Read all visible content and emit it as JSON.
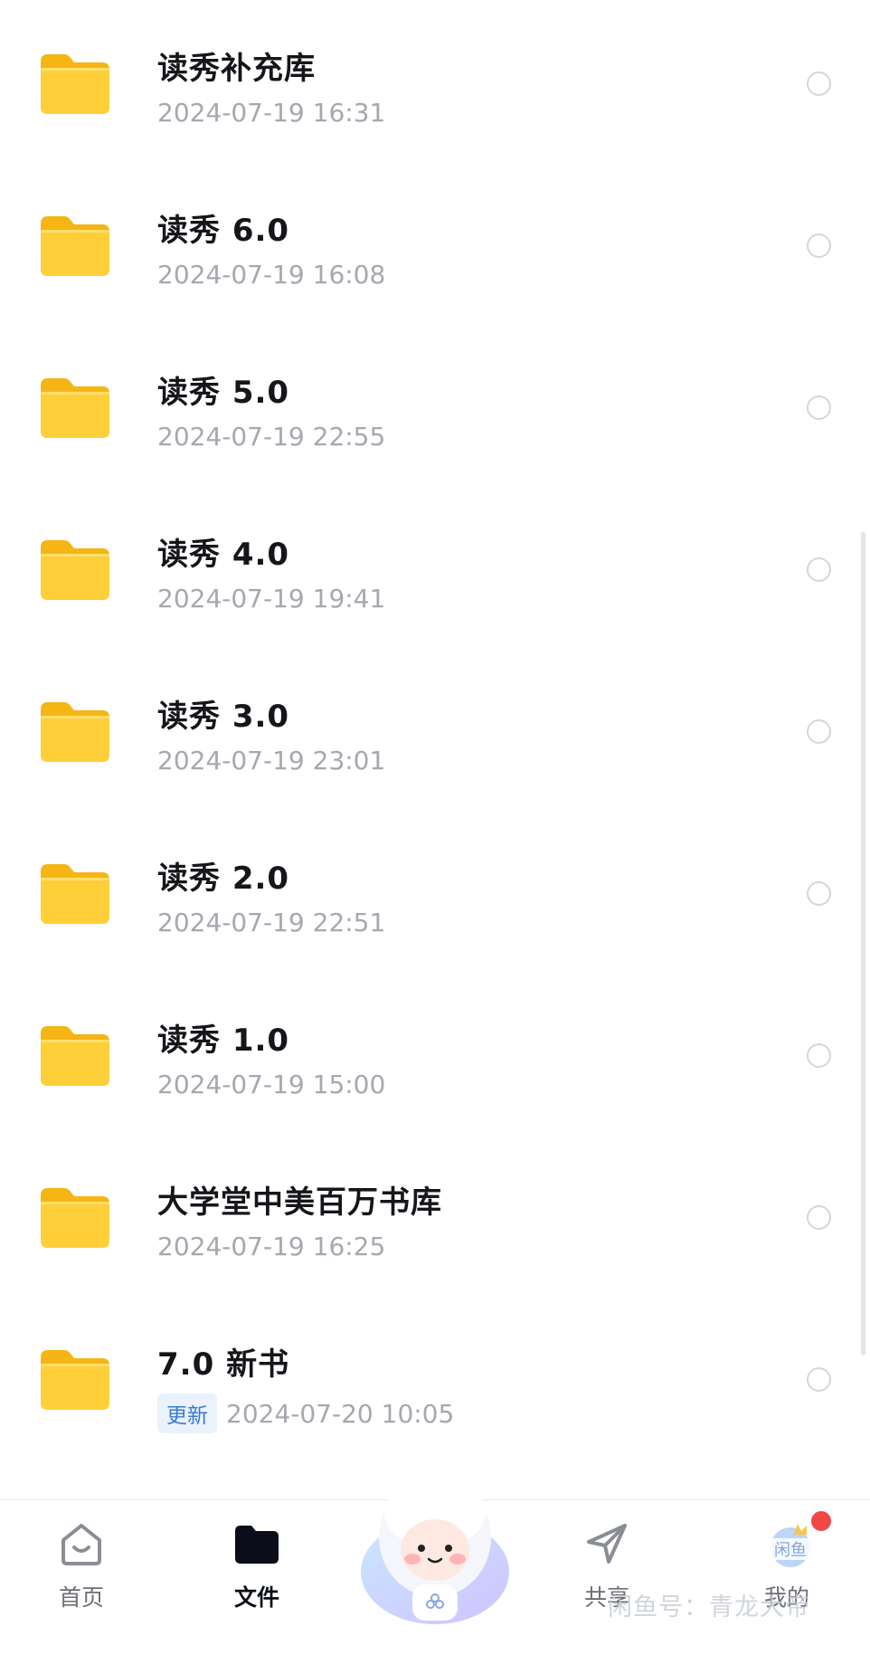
{
  "files": [
    {
      "name": "读秀补充库",
      "date": "2024-07-19 16:31",
      "badge": ""
    },
    {
      "name": "读秀 6.0",
      "date": "2024-07-19 16:08",
      "badge": ""
    },
    {
      "name": "读秀 5.0",
      "date": "2024-07-19 22:55",
      "badge": ""
    },
    {
      "name": "读秀 4.0",
      "date": "2024-07-19 19:41",
      "badge": ""
    },
    {
      "name": "读秀 3.0",
      "date": "2024-07-19 23:01",
      "badge": ""
    },
    {
      "name": "读秀 2.0",
      "date": "2024-07-19 22:51",
      "badge": ""
    },
    {
      "name": "读秀 1.0",
      "date": "2024-07-19 15:00",
      "badge": ""
    },
    {
      "name": "大学堂中美百万书库",
      "date": "2024-07-19 16:25",
      "badge": ""
    },
    {
      "name": "7.0 新书",
      "date": "2024-07-20 10:05",
      "badge": "更新"
    }
  ],
  "tabbar": {
    "home": {
      "label": "首页",
      "icon": "home-icon"
    },
    "files": {
      "label": "文件",
      "icon": "folder-icon"
    },
    "share": {
      "label": "共享",
      "icon": "send-icon"
    },
    "mine": {
      "label": "我的",
      "icon": "avatar"
    }
  },
  "watermark": "闲鱼号：青龙大帝",
  "colors": {
    "folder": "#FFCB2E",
    "accent": "#3A7BD5",
    "badge_bg": "#EAF2FC",
    "notify": "#F04747"
  }
}
